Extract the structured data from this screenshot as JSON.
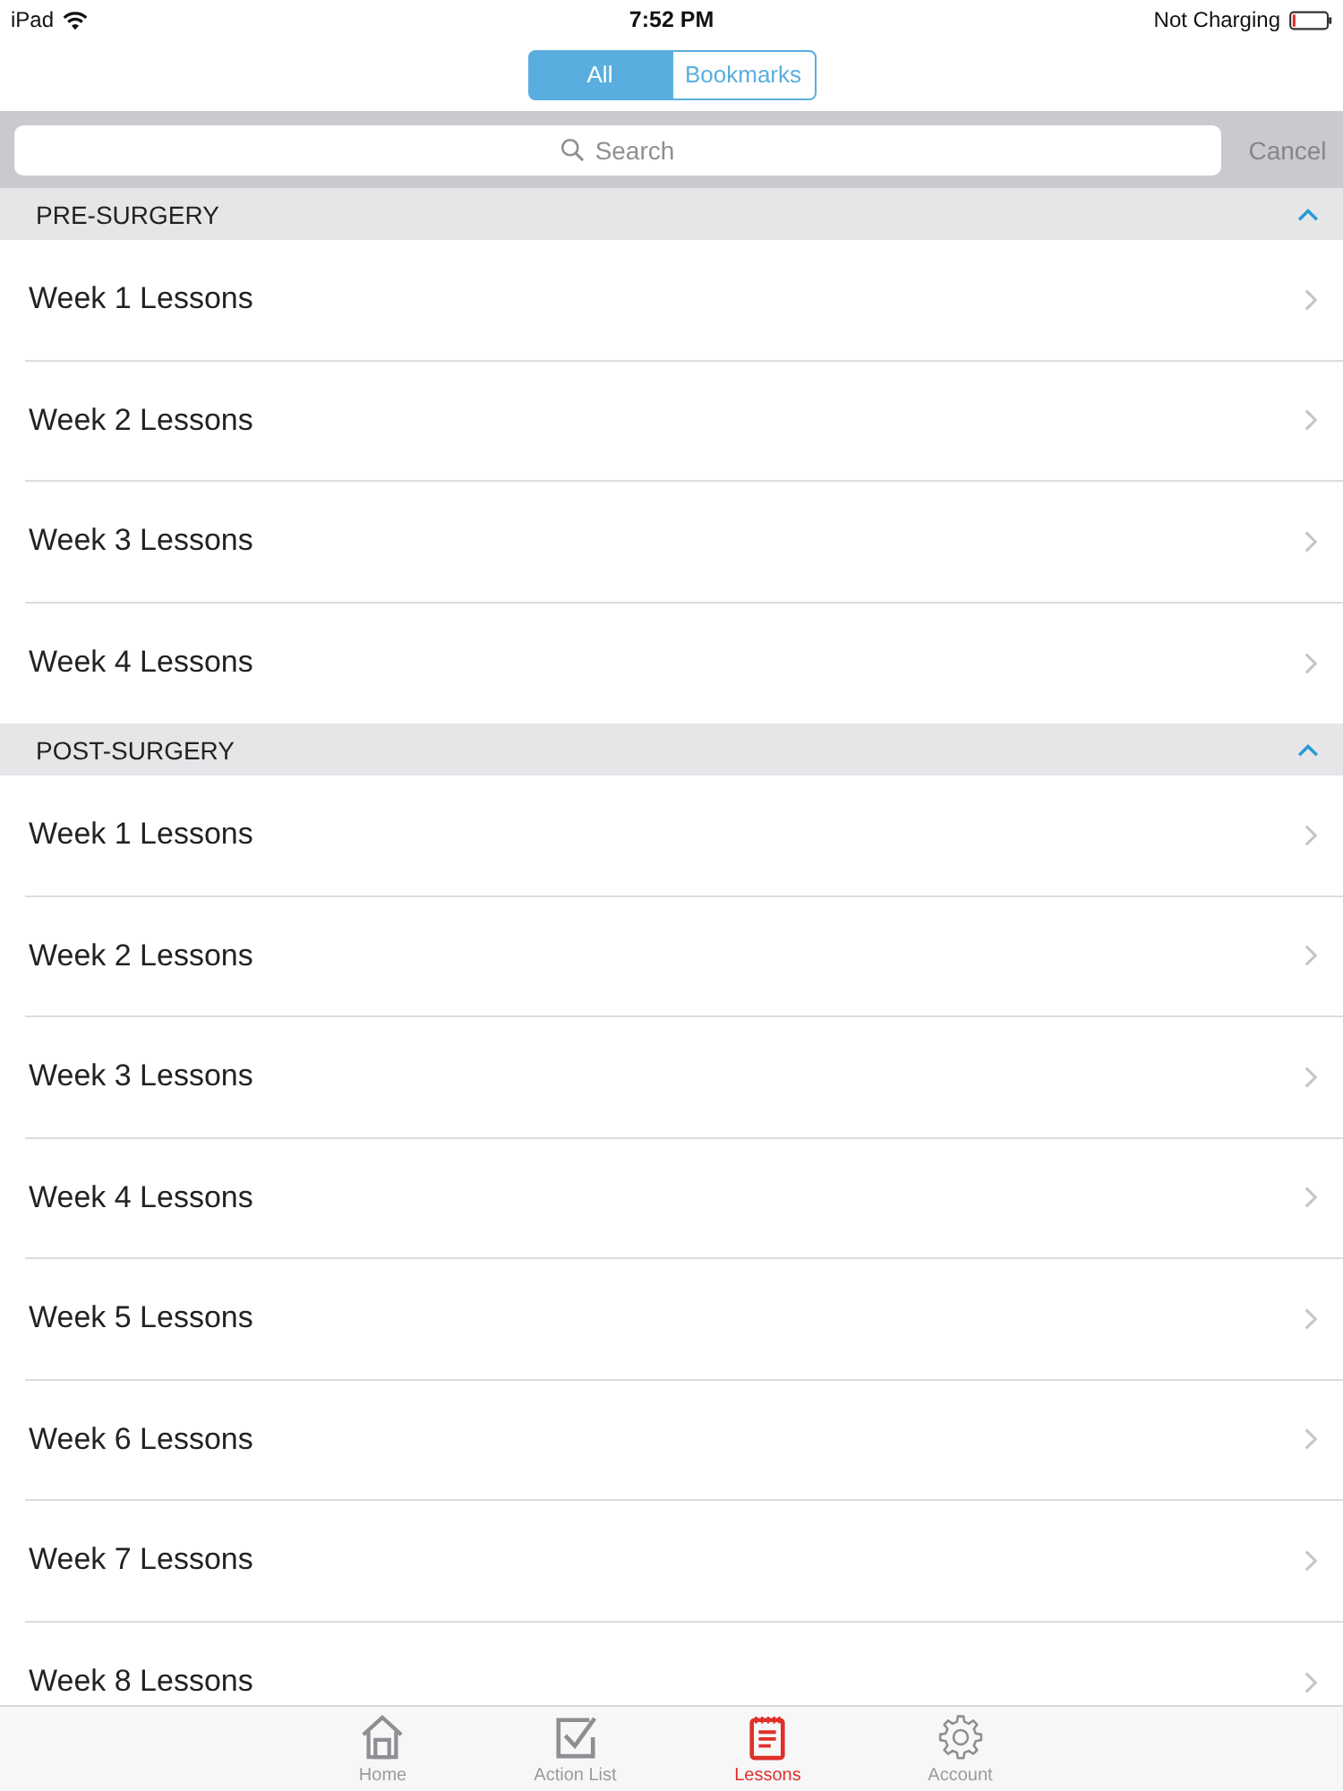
{
  "status_bar": {
    "device": "iPad",
    "time": "7:52 PM",
    "battery_status": "Not Charging"
  },
  "segmented_control": [
    {
      "label": "All",
      "selected": true
    },
    {
      "label": "Bookmarks",
      "selected": false
    }
  ],
  "search": {
    "placeholder": "Search",
    "cancel": {
      "label": "Cancel",
      "disabled": true
    }
  },
  "sections": [
    {
      "title": "PRE-SURGERY",
      "expanded": true,
      "items": [
        {
          "label": "Week 1 Lessons"
        },
        {
          "label": "Week 2 Lessons"
        },
        {
          "label": "Week 3 Lessons"
        },
        {
          "label": "Week 4 Lessons"
        }
      ]
    },
    {
      "title": "POST-SURGERY",
      "expanded": true,
      "items": [
        {
          "label": "Week 1 Lessons"
        },
        {
          "label": "Week 2 Lessons"
        },
        {
          "label": "Week 3 Lessons"
        },
        {
          "label": "Week 4 Lessons"
        },
        {
          "label": "Week 5 Lessons"
        },
        {
          "label": "Week 6 Lessons"
        },
        {
          "label": "Week 7 Lessons"
        },
        {
          "label": "Week 8 Lessons"
        }
      ]
    }
  ],
  "tab_bar": [
    {
      "label": "Home",
      "kind": "home",
      "selected": false
    },
    {
      "label": "Action List",
      "kind": "checklist",
      "selected": false
    },
    {
      "label": "Lessons",
      "kind": "notepad",
      "selected": true
    },
    {
      "label": "Account",
      "kind": "gear",
      "selected": false
    }
  ]
}
